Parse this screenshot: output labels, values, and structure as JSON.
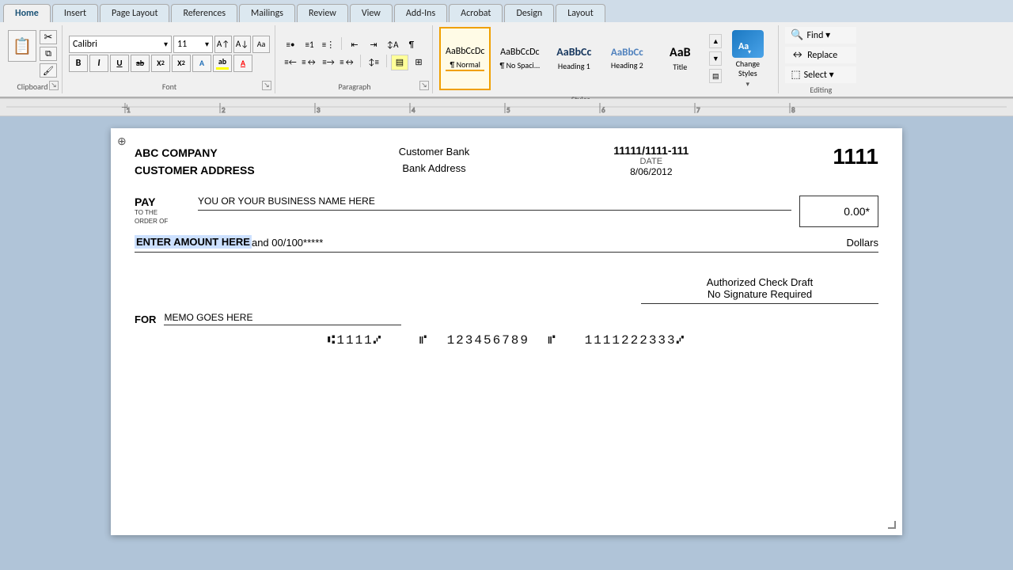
{
  "tabs": [
    {
      "label": "Home",
      "active": true
    },
    {
      "label": "Insert",
      "active": false
    },
    {
      "label": "Page Layout",
      "active": false
    },
    {
      "label": "References",
      "active": false
    },
    {
      "label": "Mailings",
      "active": false
    },
    {
      "label": "Review",
      "active": false
    },
    {
      "label": "View",
      "active": false
    },
    {
      "label": "Add-Ins",
      "active": false
    },
    {
      "label": "Acrobat",
      "active": false
    },
    {
      "label": "Design",
      "active": false
    },
    {
      "label": "Layout",
      "active": false
    }
  ],
  "font": {
    "name": "Calibri",
    "size": "11"
  },
  "styles": [
    {
      "label": "Normal",
      "preview": "AaBbCcDc",
      "active": true
    },
    {
      "label": "No Spaci...",
      "preview": "AaBbCcDc",
      "active": false
    },
    {
      "label": "Heading 1",
      "preview": "AaBbCc",
      "active": false
    },
    {
      "label": "Heading 2",
      "preview": "AaBbCc",
      "active": false
    },
    {
      "label": "Title",
      "preview": "AaB",
      "active": false
    }
  ],
  "editing": {
    "find_label": "Find ▾",
    "replace_label": "Replace",
    "select_label": "Select ▾",
    "group_label": "Editing"
  },
  "change_styles": {
    "label": "Change\nStyles",
    "sublabel": "Styles"
  },
  "check": {
    "company": "ABC COMPANY",
    "address": "CUSTOMER ADDRESS",
    "bank_name": "Customer Bank",
    "bank_address": "Bank Address",
    "routing": "11111/1111-111",
    "date_label": "DATE",
    "date_value": "8/06/2012",
    "check_number": "1111",
    "pay_label": "PAY",
    "to_the_order_of": "TO THE\nORDER OF",
    "payee": "YOU OR YOUR BUSINESS NAME HERE",
    "amount": "0.00*",
    "amount_words_highlight": "ENTER AMOUNT HERE",
    "amount_words_rest": " and 00/100*****",
    "dollars": "Dollars",
    "authorized_line1": "Authorized Check Draft",
    "authorized_line2": "No Signature Required",
    "for_label": "FOR",
    "memo": "MEMO GOES HERE",
    "micr": "⑆1111⑇  ⑆  123456789  ⑆  1111222333⑇"
  }
}
